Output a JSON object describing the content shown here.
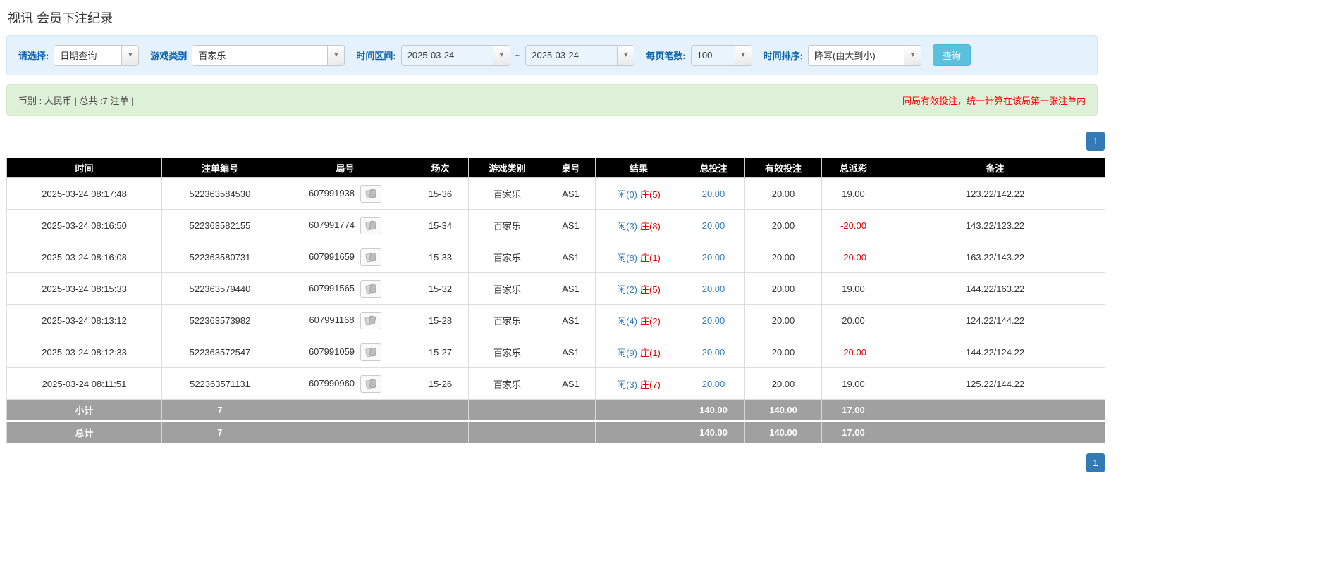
{
  "page": {
    "title": "视讯 会员下注纪录"
  },
  "icons": {
    "chevron_down": "▾"
  },
  "filters": {
    "select_label": "请选择:",
    "select_value": "日期查询",
    "game_type_label": "游戏类别",
    "game_type_value": "百家乐",
    "date_range_label": "时间区间:",
    "date_from": "2025-03-24",
    "date_separator": "~",
    "date_to": "2025-03-24",
    "page_size_label": "每页笔数:",
    "page_size_value": "100",
    "sort_label": "时间排序:",
    "sort_value": "降幂(由大到小)",
    "search_button": "查询"
  },
  "summary": {
    "info": "币别 : 人民币 | 总共 :7 注单 |",
    "notice": "同局有效投注，统一计算在该局第一张注单内"
  },
  "pagination": {
    "current_page": "1"
  },
  "table": {
    "headers": [
      "时间",
      "注单编号",
      "局号",
      "场次",
      "游戏类别",
      "桌号",
      "结果",
      "总投注",
      "有效投注",
      "总派彩",
      "备注"
    ],
    "rows": [
      {
        "time": "2025-03-24 08:17:48",
        "bet_id": "522363584530",
        "round_id": "607991938",
        "session": "15-36",
        "game": "百家乐",
        "table_no": "AS1",
        "result_player": "闲(0)",
        "result_banker": "庄(5)",
        "total_bet": "20.00",
        "valid_bet": "20.00",
        "payout": "19.00",
        "note": "123.22/142.22"
      },
      {
        "time": "2025-03-24 08:16:50",
        "bet_id": "522363582155",
        "round_id": "607991774",
        "session": "15-34",
        "game": "百家乐",
        "table_no": "AS1",
        "result_player": "闲(3)",
        "result_banker": "庄(8)",
        "total_bet": "20.00",
        "valid_bet": "20.00",
        "payout": "-20.00",
        "note": "143.22/123.22"
      },
      {
        "time": "2025-03-24 08:16:08",
        "bet_id": "522363580731",
        "round_id": "607991659",
        "session": "15-33",
        "game": "百家乐",
        "table_no": "AS1",
        "result_player": "闲(8)",
        "result_banker": "庄(1)",
        "total_bet": "20.00",
        "valid_bet": "20.00",
        "payout": "-20.00",
        "note": "163.22/143.22"
      },
      {
        "time": "2025-03-24 08:15:33",
        "bet_id": "522363579440",
        "round_id": "607991565",
        "session": "15-32",
        "game": "百家乐",
        "table_no": "AS1",
        "result_player": "闲(2)",
        "result_banker": "庄(5)",
        "total_bet": "20.00",
        "valid_bet": "20.00",
        "payout": "19.00",
        "note": "144.22/163.22"
      },
      {
        "time": "2025-03-24 08:13:12",
        "bet_id": "522363573982",
        "round_id": "607991168",
        "session": "15-28",
        "game": "百家乐",
        "table_no": "AS1",
        "result_player": "闲(4)",
        "result_banker": "庄(2)",
        "total_bet": "20.00",
        "valid_bet": "20.00",
        "payout": "20.00",
        "note": "124.22/144.22"
      },
      {
        "time": "2025-03-24 08:12:33",
        "bet_id": "522363572547",
        "round_id": "607991059",
        "session": "15-27",
        "game": "百家乐",
        "table_no": "AS1",
        "result_player": "闲(9)",
        "result_banker": "庄(1)",
        "total_bet": "20.00",
        "valid_bet": "20.00",
        "payout": "-20.00",
        "note": "144.22/124.22"
      },
      {
        "time": "2025-03-24 08:11:51",
        "bet_id": "522363571131",
        "round_id": "607990960",
        "session": "15-26",
        "game": "百家乐",
        "table_no": "AS1",
        "result_player": "闲(3)",
        "result_banker": "庄(7)",
        "total_bet": "20.00",
        "valid_bet": "20.00",
        "payout": "19.00",
        "note": "125.22/144.22"
      }
    ],
    "subtotal": {
      "label": "小计",
      "count": "7",
      "total_bet": "140.00",
      "valid_bet": "140.00",
      "payout": "17.00"
    },
    "total": {
      "label": "总计",
      "count": "7",
      "total_bet": "140.00",
      "valid_bet": "140.00",
      "payout": "17.00"
    }
  }
}
